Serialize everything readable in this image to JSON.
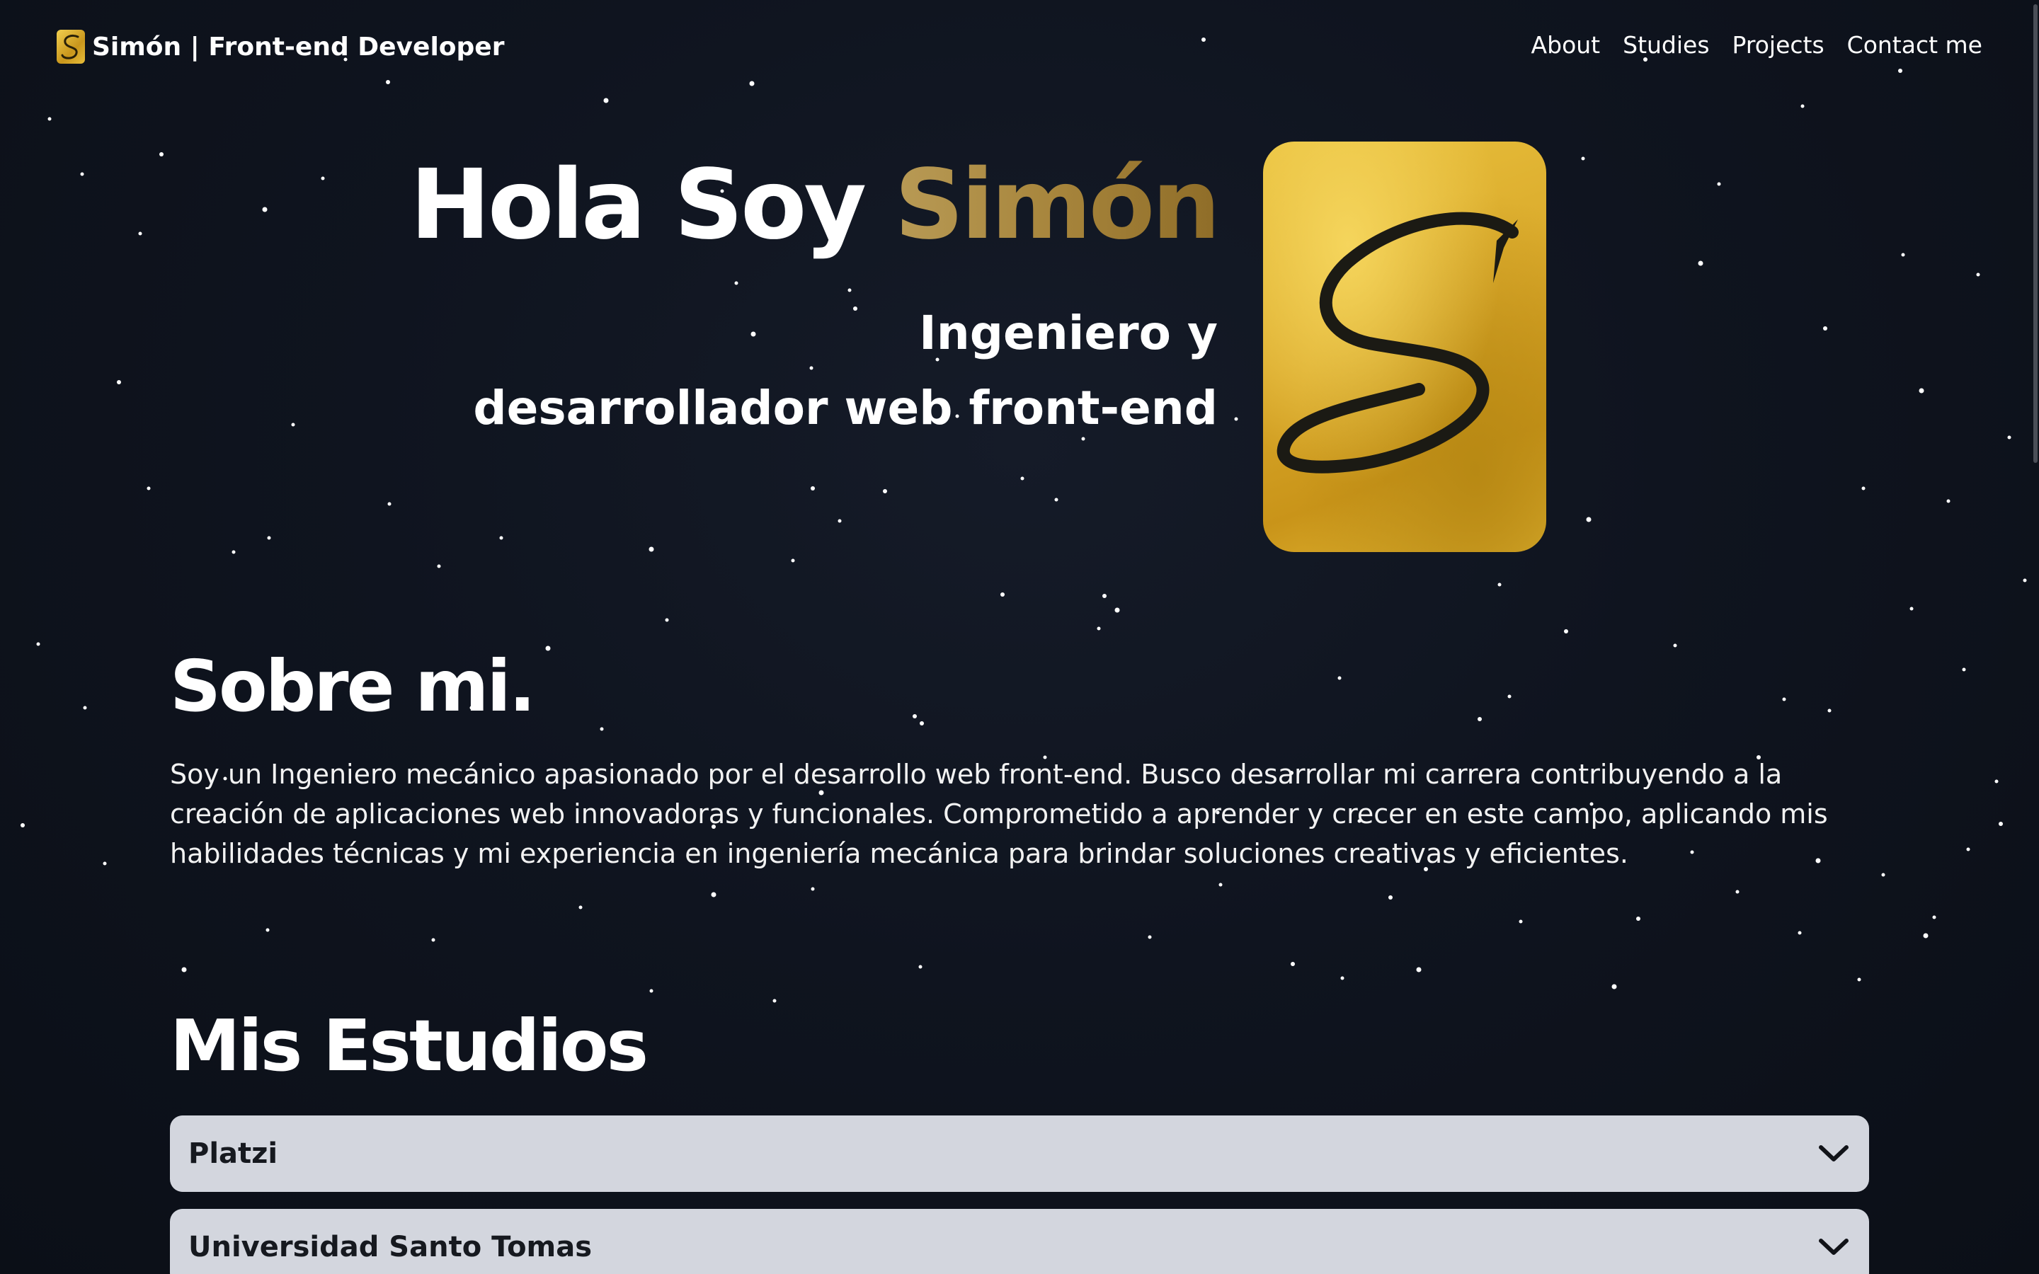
{
  "nav": {
    "brand": "Simón | Front-end Developer",
    "links": [
      "About",
      "Studies",
      "Projects",
      "Contact me"
    ]
  },
  "hero": {
    "greeting": "Hola Soy",
    "name": "Simón",
    "subtitle_line1": "Ingeniero y",
    "subtitle_line2": "desarrollador web front-end"
  },
  "about": {
    "title": "Sobre mi.",
    "text": "Soy un Ingeniero mecánico apasionado por el desarrollo web front-end. Busco desarrollar mi carrera contribuyendo a la creación de aplicaciones web innovadoras y funcionales. Comprometido a aprender y crecer en este campo, aplicando mis habilidades técnicas y mi experiencia en ingeniería mecánica para brindar soluciones creativas y eficientes."
  },
  "studies": {
    "title": "Mis Estudios",
    "items": [
      {
        "label": "Platzi"
      },
      {
        "label": "Universidad Santo Tomas"
      }
    ]
  },
  "colors": {
    "background": "#0d111b",
    "accent_gold": "#a7853c",
    "accordion_bg": "#d3d6de"
  },
  "icons": {
    "logo": "s-monogram-gold-logo",
    "accordion_toggle": "chevron-down-icon"
  }
}
